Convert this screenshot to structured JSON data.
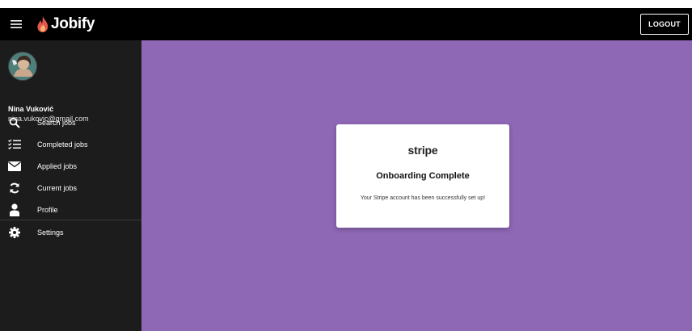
{
  "app": {
    "name": "Jobify",
    "logout_label": "LOGOUT"
  },
  "user": {
    "name": "Nina Vuković",
    "email": "nina.vukovic@gmail.com"
  },
  "sidebar": {
    "items": [
      {
        "label": "Search jobs",
        "icon": "search-icon"
      },
      {
        "label": "Completed jobs",
        "icon": "checklist-icon"
      },
      {
        "label": "Applied jobs",
        "icon": "envelope-icon"
      },
      {
        "label": "Current jobs",
        "icon": "refresh-icon"
      },
      {
        "label": "Profile",
        "icon": "person-icon"
      },
      {
        "label": "Settings",
        "icon": "gear-icon"
      }
    ]
  },
  "card": {
    "brand": "stripe",
    "title": "Onboarding Complete",
    "message": "Your Stripe account has been successfully set up!"
  },
  "colors": {
    "appbar": "#000000",
    "sidebar": "#1c1c1c",
    "main_background": "#8e67b5",
    "card": "#ffffff",
    "logo_flame": "#e2574c"
  }
}
